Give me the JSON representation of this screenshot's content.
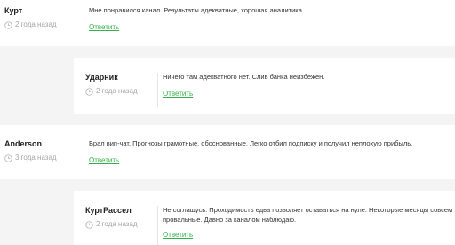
{
  "comments": [
    {
      "author": "Курт",
      "date": "2 года назад",
      "text": "Мне понравился канал. Результаты адекватные, хорошая аналитика.",
      "reply_label": "Ответить"
    },
    {
      "author": "Ударник",
      "date": "2 года назад",
      "text": "Ничего там адекватного нет. Слив банка неизбежен.",
      "reply_label": "Ответить"
    },
    {
      "author": "Anderson",
      "date": "3 года назад",
      "text": "Брал вип-чат. Прогнозы грамотные, обоснованные. Легко отбил подписку и получил неплохую прибыль.",
      "reply_label": "Ответить"
    },
    {
      "author": "КуртРассел",
      "date": "2 года назад",
      "text": "Не соглашусь. Проходимость едва позволяет оставаться на нуле. Некоторые месяцы совсем провальные. Давно за каналом наблюдаю.",
      "reply_label": "Ответить"
    }
  ]
}
